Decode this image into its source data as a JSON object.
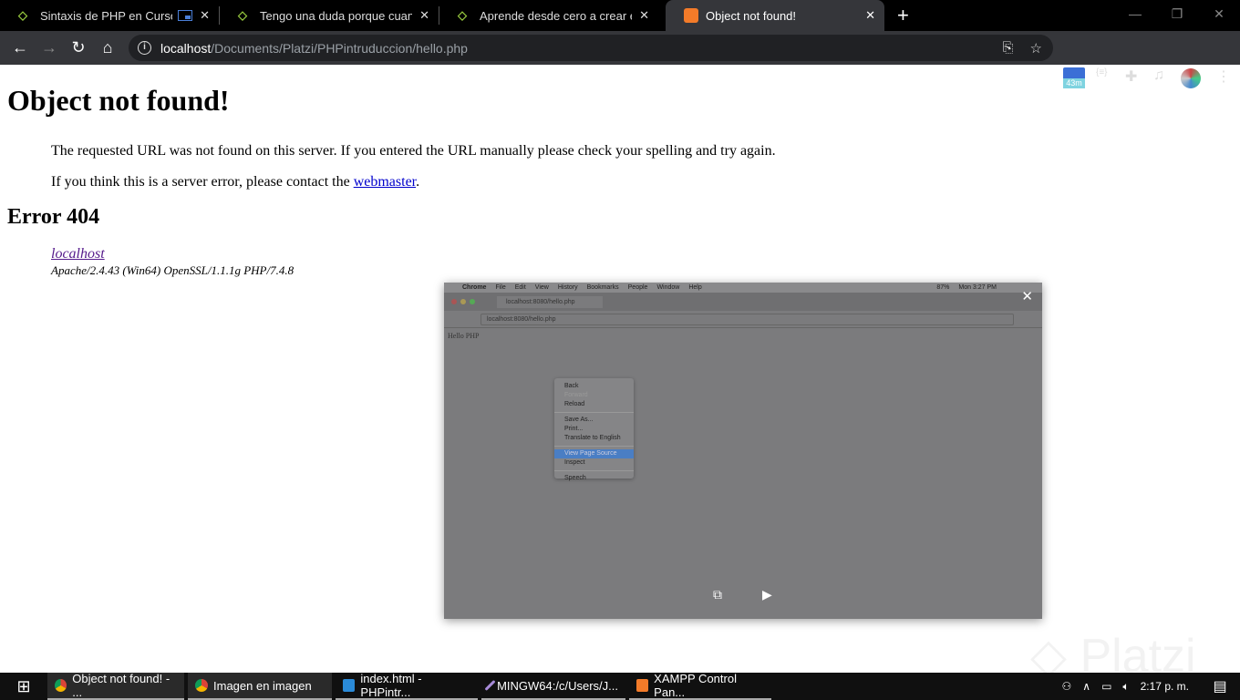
{
  "browser": {
    "tabs": [
      {
        "title": "Sintaxis de PHP en Curso de",
        "favicon": "platzi-icon",
        "active": false,
        "pip": true
      },
      {
        "title": "Tengo una duda porque cuando",
        "favicon": "platzi-icon",
        "active": false
      },
      {
        "title": "Aprende desde cero a crear el fut",
        "favicon": "platzi-icon",
        "active": false
      },
      {
        "title": "Object not found!",
        "favicon": "xampp-icon",
        "active": true
      }
    ],
    "url_host": "localhost",
    "url_path": "/Documents/Platzi/PHPintruduccion/hello.php",
    "extension_badge": "43m"
  },
  "page": {
    "title": "Object not found!",
    "p1": "The requested URL was not found on this server. If you entered the URL manually please check your spelling and try again.",
    "p2_pre": "If you think this is a server error, please contact the ",
    "p2_link": "webmaster",
    "p2_post": ".",
    "error": "Error 404",
    "server_link": "localhost",
    "server_sig": "Apache/2.4.43 (Win64) OpenSSL/1.1.1g PHP/7.4.8"
  },
  "pip": {
    "menubar": [
      "Chrome",
      "File",
      "Edit",
      "View",
      "History",
      "Bookmarks",
      "People",
      "Window",
      "Help"
    ],
    "status": "87%",
    "clock": "Mon 3:27 PM",
    "tab_title": "localhost:8080/hello.php",
    "url": "localhost:8080/hello.php",
    "content": "Hello PHP",
    "context_menu": [
      "Back",
      "Forward",
      "Reload",
      "Save As...",
      "Print...",
      "Translate to English",
      "View Page Source",
      "Inspect",
      "Speech"
    ]
  },
  "taskbar": {
    "items": [
      "Object not found! - ...",
      "Imagen en imagen",
      "index.html - PHPintr...",
      "MINGW64:/c/Users/J...",
      "XAMPP Control Pan..."
    ],
    "time": "2:17 p. m."
  },
  "watermark": "Platzi"
}
